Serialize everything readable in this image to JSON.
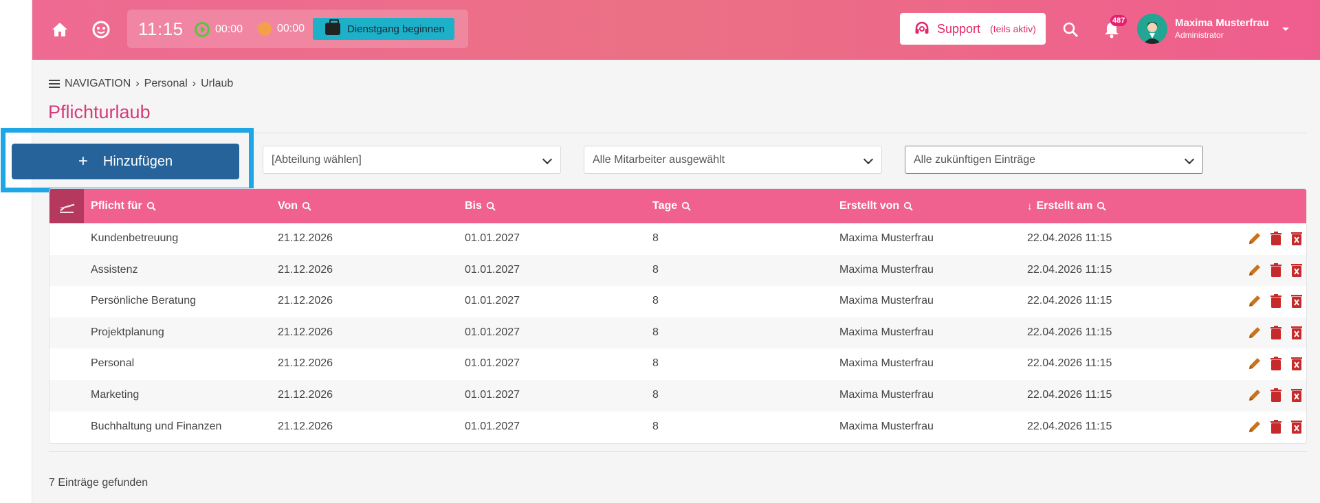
{
  "header": {
    "time": "11:15",
    "timer_green": "00:00",
    "timer_orange": "00:00",
    "dienstgang_label": "Dienstgang beginnen",
    "support_label": "Support",
    "support_sub": "(teils aktiv)",
    "notification_count": "487",
    "user_name": "Maxima Musterfrau",
    "user_role": "Administrator"
  },
  "breadcrumb": {
    "nav": "NAVIGATION",
    "level1": "Personal",
    "level2": "Urlaub"
  },
  "page": {
    "title": "Pflichturlaub",
    "add_label": "Hinzufügen",
    "filter_department": "[Abteilung wählen]",
    "filter_employees": "Alle Mitarbeiter ausgewählt",
    "filter_entries": "Alle zukünftigen Einträge",
    "entries_found": "7 Einträge gefunden"
  },
  "table": {
    "columns": [
      "Pflicht für",
      "Von",
      "Bis",
      "Tage",
      "Erstellt von",
      "Erstellt am"
    ],
    "rows": [
      [
        "Kundenbetreuung",
        "21.12.2026",
        "01.01.2027",
        "8",
        "Maxima Musterfrau",
        "22.04.2026 11:15"
      ],
      [
        "Assistenz",
        "21.12.2026",
        "01.01.2027",
        "8",
        "Maxima Musterfrau",
        "22.04.2026 11:15"
      ],
      [
        "Persönliche Beratung",
        "21.12.2026",
        "01.01.2027",
        "8",
        "Maxima Musterfrau",
        "22.04.2026 11:15"
      ],
      [
        "Projektplanung",
        "21.12.2026",
        "01.01.2027",
        "8",
        "Maxima Musterfrau",
        "22.04.2026 11:15"
      ],
      [
        "Personal",
        "21.12.2026",
        "01.01.2027",
        "8",
        "Maxima Musterfrau",
        "22.04.2026 11:15"
      ],
      [
        "Marketing",
        "21.12.2026",
        "01.01.2027",
        "8",
        "Maxima Musterfrau",
        "22.04.2026 11:15"
      ],
      [
        "Buchhaltung und Finanzen",
        "21.12.2026",
        "01.01.2027",
        "8",
        "Maxima Musterfrau",
        "22.04.2026 11:15"
      ]
    ]
  },
  "icons": {
    "home": "home-icon",
    "mood": "smiley-icon",
    "briefcase": "briefcase-icon",
    "support": "headset-icon",
    "search": "search-icon",
    "bell": "bell-icon",
    "plane": "plane-icon",
    "sort": "arrow-down-icon",
    "edit": "pencil-icon",
    "delete": "trash-icon",
    "remove": "delete-box-icon"
  },
  "colors": {
    "header_pink": "#ee6a92",
    "table_head": "#f06190",
    "title_pink": "#d63a78",
    "add_button": "#25639a",
    "highlight": "#1ea6e6",
    "dienstgang": "#1db0c9",
    "edit_icon": "#c8741a",
    "delete_icon": "#c62a2a"
  }
}
